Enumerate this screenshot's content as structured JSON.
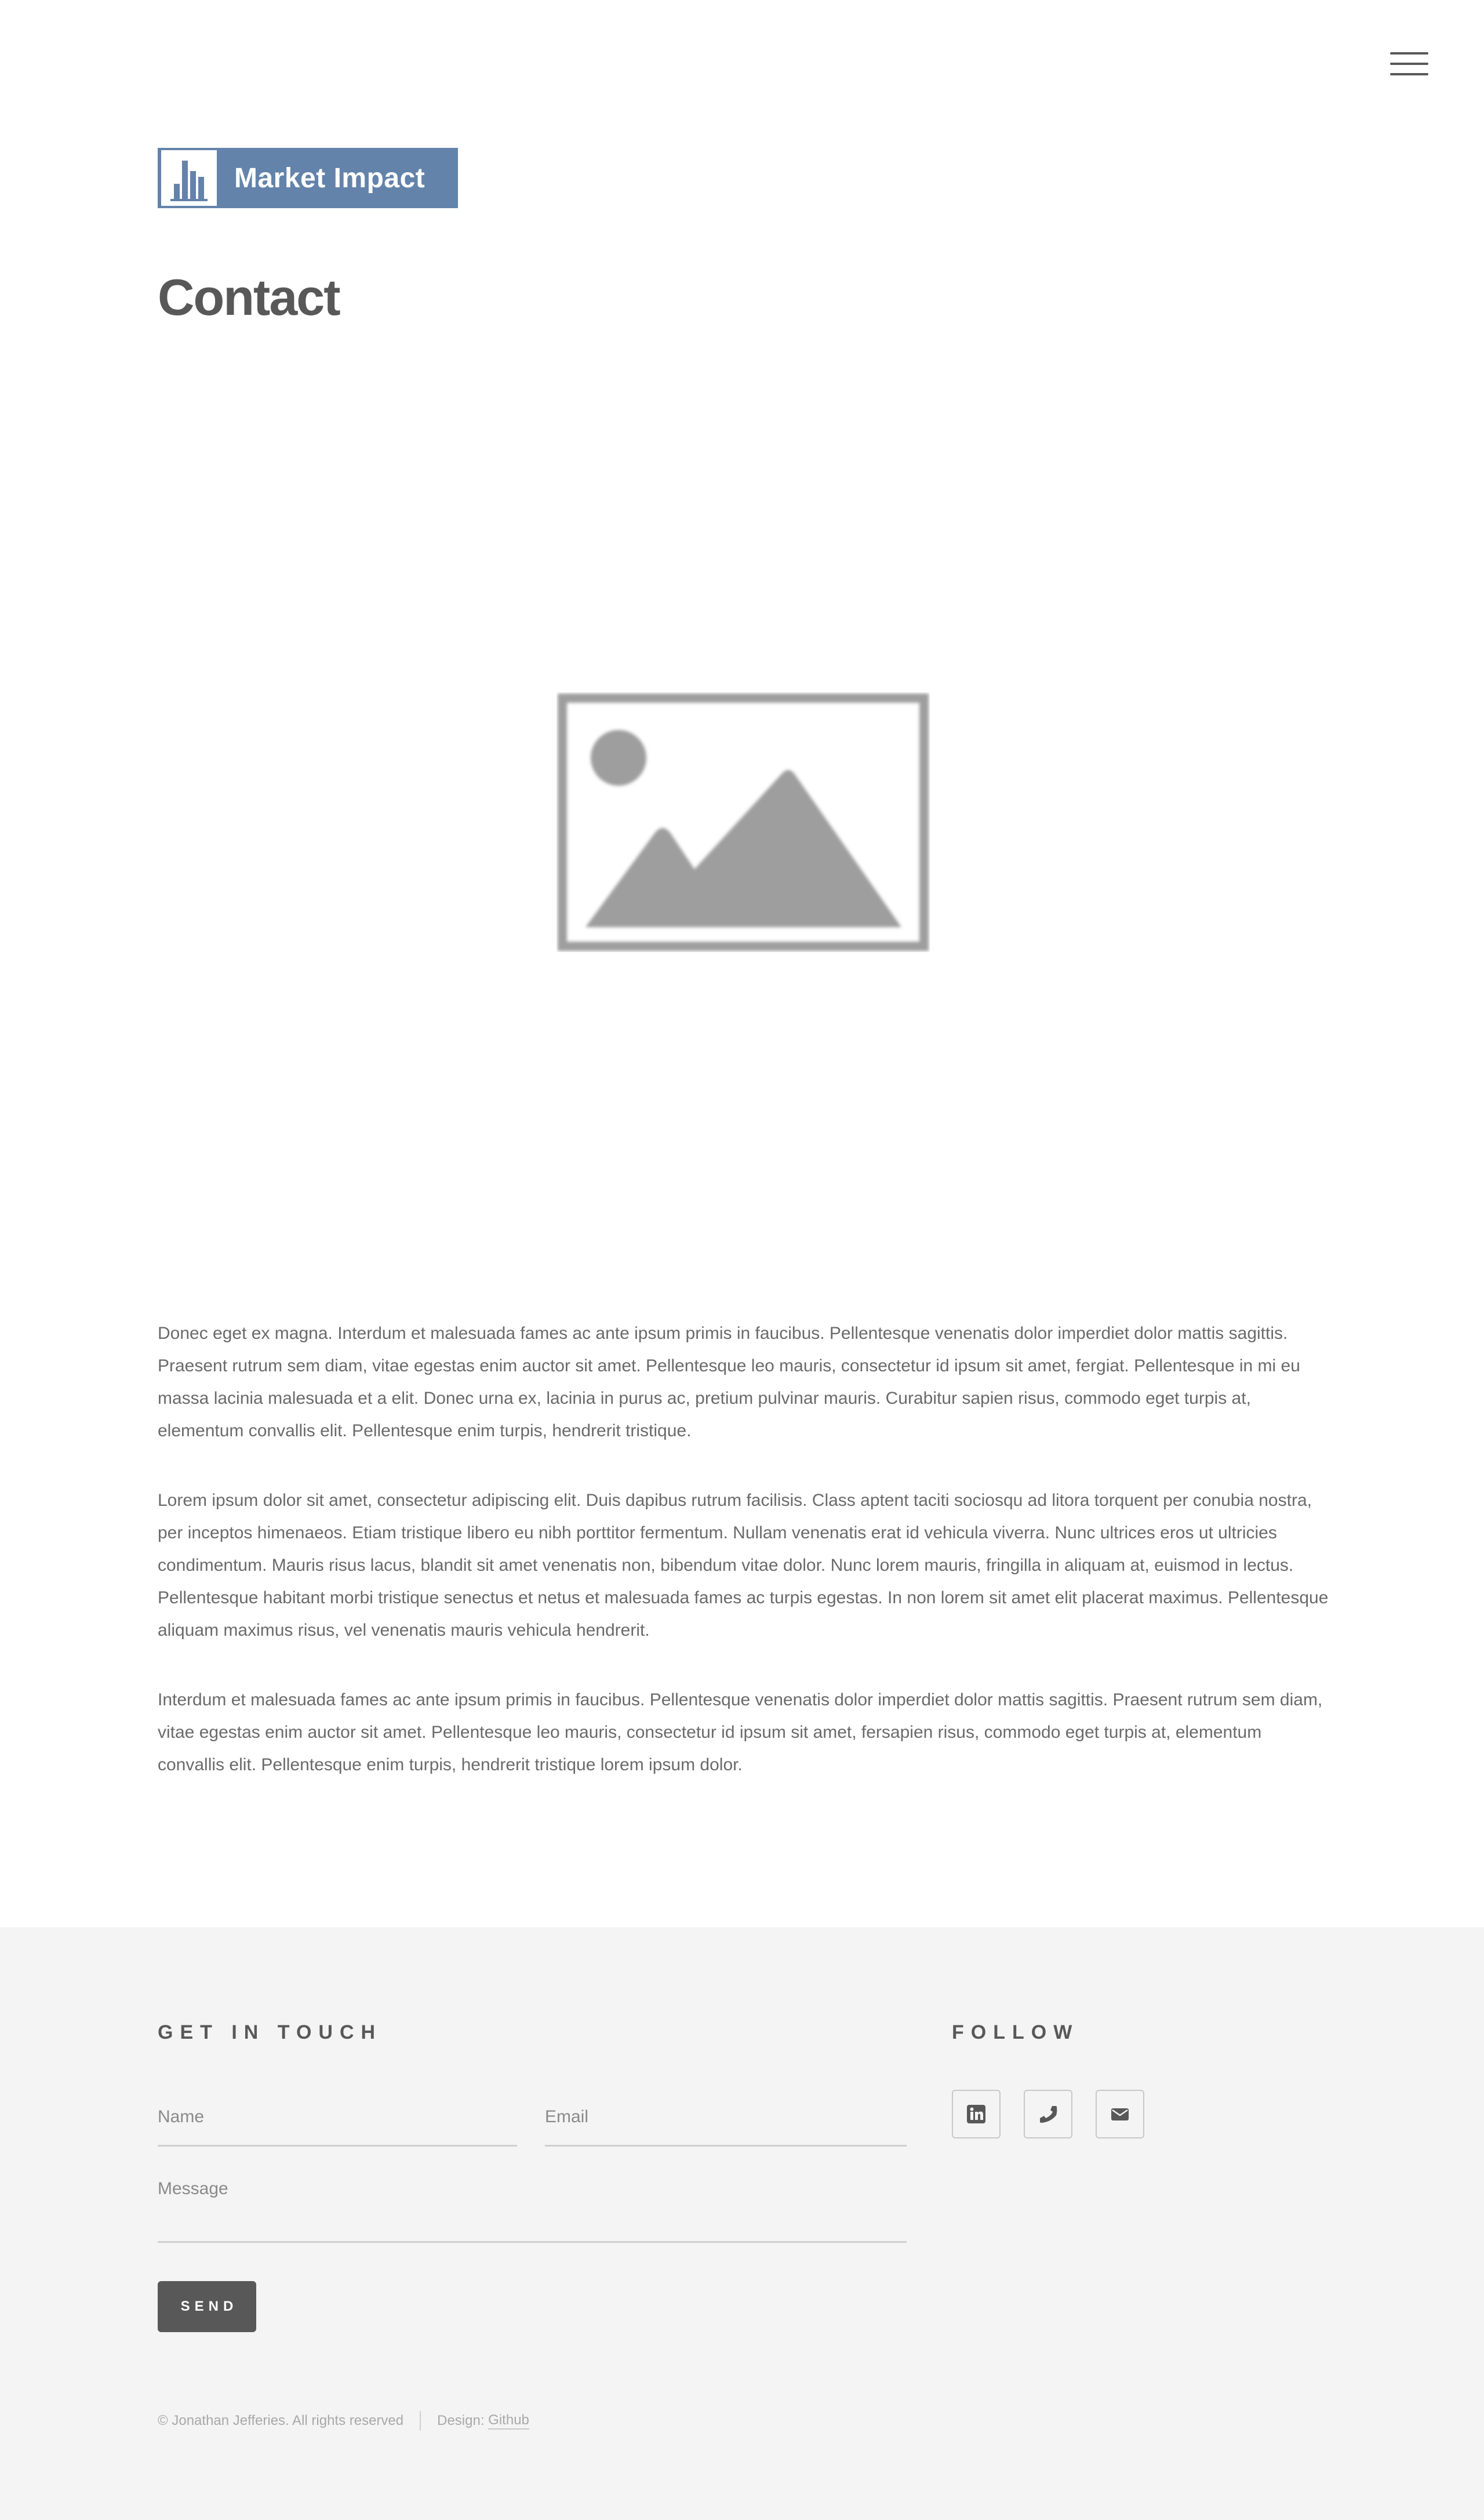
{
  "header": {
    "menu_icon": "hamburger-menu-icon",
    "logo": {
      "text": "Market Impact",
      "icon": "bar-chart-icon",
      "color": "#6383aa"
    }
  },
  "main": {
    "title": "Contact",
    "image_icon": "image-placeholder-icon",
    "paragraphs": [
      "Donec eget ex magna. Interdum et malesuada fames ac ante ipsum primis in faucibus. Pellentesque venenatis dolor imperdiet dolor mattis sagittis. Praesent rutrum sem diam, vitae egestas enim auctor sit amet. Pellentesque leo mauris, consectetur id ipsum sit amet, fergiat. Pellentesque in mi eu massa lacinia malesuada et a elit. Donec urna ex, lacinia in purus ac, pretium pulvinar mauris. Curabitur sapien risus, commodo eget turpis at, elementum convallis elit. Pellentesque enim turpis, hendrerit tristique.",
      "Lorem ipsum dolor sit amet, consectetur adipiscing elit. Duis dapibus rutrum facilisis. Class aptent taciti sociosqu ad litora torquent per conubia nostra, per inceptos himenaeos. Etiam tristique libero eu nibh porttitor fermentum. Nullam venenatis erat id vehicula viverra. Nunc ultrices eros ut ultricies condimentum. Mauris risus lacus, blandit sit amet venenatis non, bibendum vitae dolor. Nunc lorem mauris, fringilla in aliquam at, euismod in lectus. Pellentesque habitant morbi tristique senectus et netus et malesuada fames ac turpis egestas. In non lorem sit amet elit placerat maximus. Pellentesque aliquam maximus risus, vel venenatis mauris vehicula hendrerit.",
      "Interdum et malesuada fames ac ante ipsum primis in faucibus. Pellentesque venenatis dolor imperdiet dolor mattis sagittis. Praesent rutrum sem diam, vitae egestas enim auctor sit amet. Pellentesque leo mauris, consectetur id ipsum sit amet, fersapien risus, commodo eget turpis at, elementum convallis elit. Pellentesque enim turpis, hendrerit tristique lorem ipsum dolor."
    ]
  },
  "footer": {
    "contact": {
      "heading": "GET IN TOUCH",
      "name_placeholder": "Name",
      "email_placeholder": "Email",
      "message_placeholder": "Message",
      "send_label": "SEND"
    },
    "follow": {
      "heading": "FOLLOW",
      "icons": [
        "linkedin-icon",
        "phone-icon",
        "envelope-icon"
      ]
    },
    "copyright": "© Jonathan Jefferies. All rights reserved",
    "design_label": "Design:",
    "design_link": "Github"
  },
  "colors": {
    "text": "#585858",
    "footer_bg": "#f4f4f4",
    "placeholder_gray": "#a0a0a0"
  }
}
